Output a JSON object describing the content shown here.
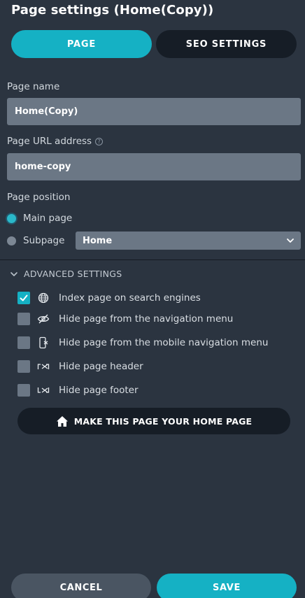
{
  "title": "Page settings (Home(Copy))",
  "tabs": [
    {
      "label": "PAGE",
      "active": true
    },
    {
      "label": "SEO SETTINGS",
      "active": false
    }
  ],
  "page_name": {
    "label": "Page name",
    "value": "Home(Copy)"
  },
  "page_url": {
    "label": "Page URL address",
    "value": "home-copy",
    "help_icon": "question-circle-icon"
  },
  "page_position": {
    "label": "Page position",
    "options": [
      {
        "label": "Main page",
        "selected": true
      },
      {
        "label": "Subpage",
        "selected": false
      }
    ],
    "parent_select": {
      "value": "Home"
    }
  },
  "advanced": {
    "label": "ADVANCED SETTINGS",
    "expanded": true,
    "options": [
      {
        "label": "Index page on search engines",
        "checked": true,
        "icon": "globe-icon"
      },
      {
        "label": "Hide page from the navigation menu",
        "checked": false,
        "icon": "eye-slash-icon"
      },
      {
        "label": "Hide page from the mobile navigation menu",
        "checked": false,
        "icon": "mobile-hidden-icon"
      },
      {
        "label": "Hide page header",
        "checked": false,
        "icon": "header-hidden-icon"
      },
      {
        "label": "Hide page footer",
        "checked": false,
        "icon": "footer-hidden-icon"
      }
    ]
  },
  "home_button": {
    "label": "MAKE THIS PAGE YOUR HOME PAGE",
    "icon": "home-icon"
  },
  "footer": {
    "cancel_label": "CANCEL",
    "save_label": "SAVE"
  },
  "colors": {
    "background": "#2b3440",
    "accent": "#15b1c4",
    "dark_button": "#161d26",
    "field": "#6b7785",
    "cancel": "#4a5562"
  }
}
